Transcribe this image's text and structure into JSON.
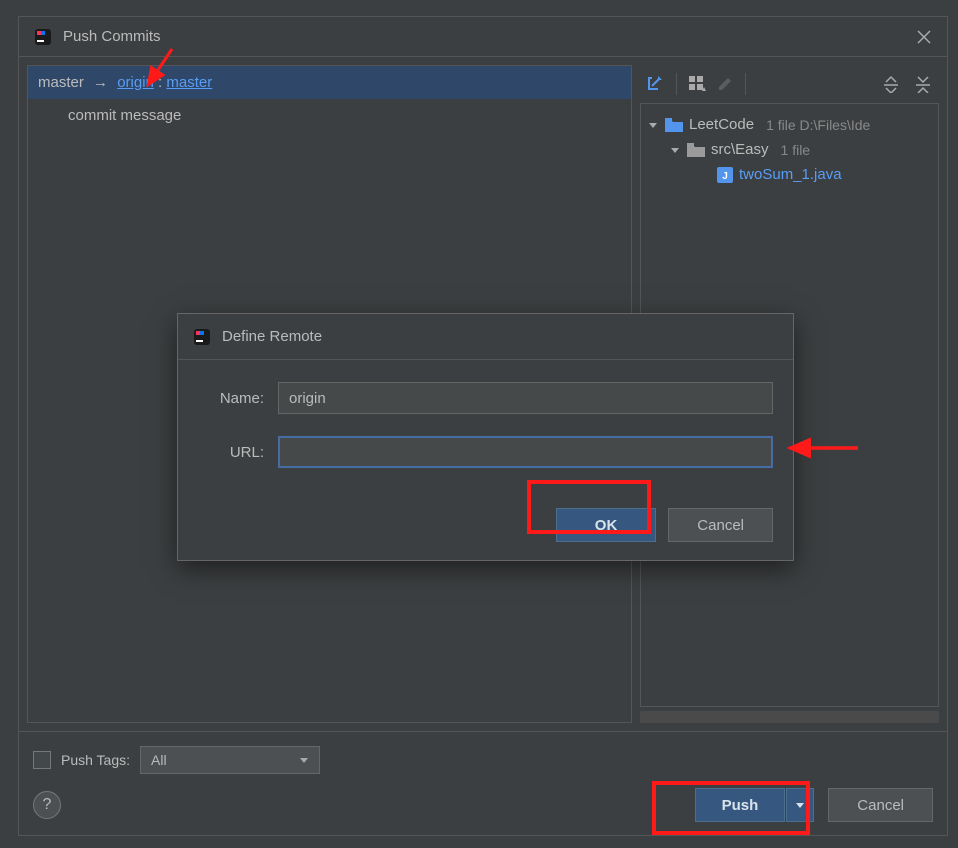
{
  "dialog": {
    "title": "Push Commits"
  },
  "branch": {
    "local": "master",
    "arrow": "→",
    "remote": "origin",
    "colon": " : ",
    "tracking": "master"
  },
  "commits": {
    "message": "commit message"
  },
  "tree": {
    "project": "LeetCode",
    "project_meta": "1 file  D:\\Files\\Ide",
    "folder": "src\\Easy",
    "folder_meta": "1 file",
    "file": "twoSum_1.java"
  },
  "push_tags": {
    "label": "Push Tags:",
    "selected": "All"
  },
  "actions": {
    "push": "Push",
    "cancel": "Cancel",
    "help": "?"
  },
  "define_remote": {
    "title": "Define Remote",
    "name_label": "Name:",
    "name_value": "origin",
    "url_label": "URL:",
    "url_value": "",
    "ok": "OK",
    "cancel": "Cancel"
  }
}
